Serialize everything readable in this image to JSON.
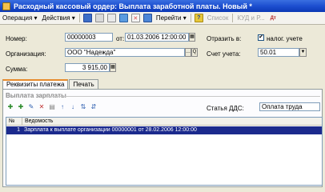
{
  "window": {
    "title": "Расходный кассовый ордер: Выплата заработной платы. Новый *"
  },
  "toolbar": {
    "operation_label": "Операция ▾",
    "actions_label": "Действия ▾",
    "goto_label": "Перейти ▾",
    "help_label": "?",
    "list_label": "Список",
    "kudir_label": "КУД и Р..."
  },
  "header": {
    "number_label": "Номер:",
    "number_value": "00000003",
    "date_prefix": "от:",
    "date_value": "01.03.2006 12:00:00",
    "reflect_label": "Отразить в:",
    "tax_checkbox_label": "налог. учете",
    "tax_checked": "✔",
    "org_label": "Организация:",
    "org_value": "ООО \"Надежда\"",
    "account_label": "Счет учета:",
    "account_value": "50.01",
    "sum_label": "Сумма:",
    "sum_value": "3 915,00"
  },
  "tabs": [
    {
      "label": "Реквизиты платежа",
      "active": true
    },
    {
      "label": "Печать",
      "active": false
    }
  ],
  "payment": {
    "section_title": "Выплата зарплаты",
    "dds_label": "Статья ДДС:",
    "dds_value": "Оплата труда"
  },
  "grid": {
    "columns": [
      "№",
      "Ведомость"
    ],
    "rows": [
      {
        "n": "1",
        "statement": "Зарплата к выплате организации 00000001 от 28.02.2006 12:00:00"
      }
    ]
  },
  "colors": {
    "titlebar": "#0b38b5",
    "selection": "#1b2a8d",
    "tab_accent": "#e68b2c"
  }
}
